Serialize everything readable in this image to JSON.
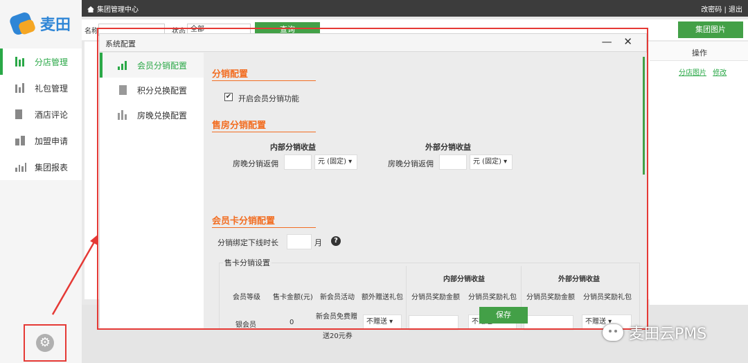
{
  "app": {
    "logo_text": "麦田",
    "title": "集团管理中心",
    "links": "改密码 | 退出"
  },
  "sidebar": {
    "items": [
      {
        "label": "分店管理",
        "icon": "building-icon",
        "active": true
      },
      {
        "label": "礼包管理",
        "icon": "gift-icon",
        "active": false
      },
      {
        "label": "酒店评论",
        "icon": "comment-icon",
        "active": false
      },
      {
        "label": "加盟申请",
        "icon": "join-icon",
        "active": false
      },
      {
        "label": "集团报表",
        "icon": "chart-icon",
        "active": false
      }
    ],
    "settings_icon": "gear-icon"
  },
  "filter": {
    "name_label": "名称",
    "status_label": "状态",
    "status_value": "全部",
    "query_label": "查询",
    "image_button": "集团图片"
  },
  "table": {
    "ops_header": "操作",
    "row_link_images": "分店图片",
    "row_link_edit": "修改"
  },
  "dialog": {
    "title": "系统配置",
    "controls": "— ✕",
    "nav": [
      {
        "label": "会员分销配置",
        "active": true
      },
      {
        "label": "积分兑换配置",
        "active": false
      },
      {
        "label": "房晚兑换配置",
        "active": false
      }
    ],
    "distribution": {
      "title": "分销配置",
      "enable_label": "开启会员分销功能",
      "enabled": true
    },
    "room_sales": {
      "title": "售房分销配置",
      "internal_header": "内部分销收益",
      "external_header": "外部分销收益",
      "internal_label": "房晚分销返佣",
      "external_label": "房晚分销返佣",
      "internal_unit": "元 (固定)",
      "external_unit": "元 (固定)"
    },
    "member_card": {
      "title": "会员卡分销配置",
      "bind_label": "分销绑定下线时长",
      "bind_unit": "月",
      "card_settings_legend": "售卡分销设置",
      "headers": {
        "level": "会员等级",
        "amount": "售卡金额(元)",
        "new_activity": "新会员活动",
        "extra_gift": "额外赠送礼包",
        "internal_group": "内部分销收益",
        "external_group": "外部分销收益",
        "internal_reward": "分销员奖励金额",
        "internal_gift": "分销员奖励礼包",
        "external_reward": "分销员奖励金额",
        "external_gift": "分销员奖励礼包"
      },
      "row": {
        "level": "银会员",
        "amount": "0",
        "new_activity_line1": "新会员免费赠",
        "new_activity_line2": "送20元券",
        "extra_gift": "不赠送",
        "internal_gift": "不赠送",
        "external_gift": "不赠送"
      }
    },
    "save_label": "保存"
  },
  "watermark": "麦田云PMS"
}
